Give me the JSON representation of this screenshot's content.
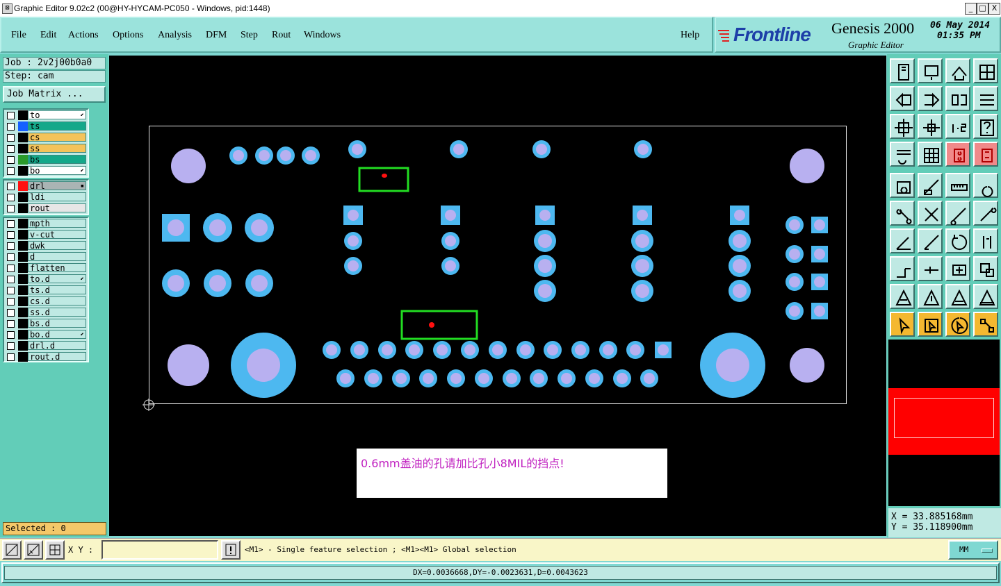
{
  "window": {
    "title": "Graphic Editor 9.02c2 (00@HY-HYCAM-PC050 - Windows, pid:1448)",
    "minimize": "_",
    "maximize": "□",
    "close": "X"
  },
  "menu": {
    "items": [
      "File",
      "Edit",
      "Actions",
      "Options",
      "Analysis",
      "DFM",
      "Step",
      "Rout",
      "Windows"
    ],
    "help": "Help"
  },
  "brand": {
    "logo": "Frontline",
    "product": "Genesis 2000",
    "subtitle": "Graphic Editor",
    "date": "06 May 2014",
    "time": "01:35 PM"
  },
  "job": {
    "job_label": "Job : 2v2j00b0a0",
    "step_label": "Step: cam",
    "matrix_button": "Job Matrix ..."
  },
  "layers": {
    "group1": [
      {
        "name": "to",
        "color": "#ffffff",
        "swatch": "#000000",
        "marker": "⬋"
      },
      {
        "name": "ts",
        "color": "#14a88a",
        "swatch": "#1560ff",
        "marker": ""
      },
      {
        "name": "cs",
        "color": "#f4c35a",
        "swatch": "#000000",
        "marker": ""
      },
      {
        "name": "ss",
        "color": "#f4c35a",
        "swatch": "#000000",
        "marker": ""
      },
      {
        "name": "bs",
        "color": "#14a88a",
        "swatch": "#2a9a2a",
        "marker": ""
      },
      {
        "name": "bo",
        "color": "#ffffff",
        "swatch": "#000000",
        "marker": "⬋"
      }
    ],
    "group2": [
      {
        "name": "drl",
        "color": "#a9b4b4",
        "swatch": "#ff1010",
        "marker": "▪"
      },
      {
        "name": "ldi",
        "color": "#bfe9e3",
        "swatch": "#000000",
        "marker": ""
      },
      {
        "name": "rout",
        "color": "#e6e6e6",
        "swatch": "#000000",
        "marker": ""
      }
    ],
    "group3": [
      {
        "name": "mpth",
        "marker": ""
      },
      {
        "name": "v-cut",
        "marker": ""
      },
      {
        "name": "dwk",
        "marker": ""
      },
      {
        "name": "d",
        "marker": ""
      },
      {
        "name": "flatten",
        "marker": ""
      },
      {
        "name": "to.d",
        "marker": "⬋"
      },
      {
        "name": "ts.d",
        "marker": ""
      },
      {
        "name": "cs.d",
        "marker": ""
      },
      {
        "name": "ss.d",
        "marker": ""
      },
      {
        "name": "bs.d",
        "marker": ""
      },
      {
        "name": "bo.d",
        "marker": "⬋"
      },
      {
        "name": "drl.d",
        "marker": ""
      },
      {
        "name": "rout.d",
        "marker": ""
      }
    ]
  },
  "selected_label": "Selected : 0",
  "canvas": {
    "note_text": "0.6mm盖油的孔请加比孔小8MIL的挡点!",
    "pad_color": "#4db8f0",
    "hole_color": "#b8b0f0",
    "highlight_color": "#22dd22",
    "drill_mark_color": "#ff1010"
  },
  "coords": {
    "x": "X = 33.885168mm",
    "y": "Y = 35.118900mm"
  },
  "command": {
    "xy_label": "X Y :",
    "xy_value": "",
    "help_text": "<M1> - Single feature selection ; <M1><M1> Global selection",
    "units": "MM"
  },
  "status": "DX=0.0036668,DY=-0.0023631,D=0.0043623"
}
